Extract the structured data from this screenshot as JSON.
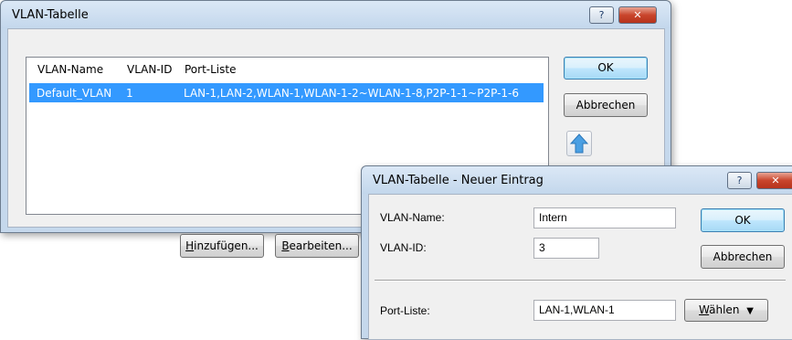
{
  "main_dialog": {
    "title": "VLAN-Tabelle",
    "help_glyph": "?",
    "close_glyph": "✕",
    "columns": [
      "VLAN-Name",
      "VLAN-ID",
      "Port-Liste"
    ],
    "rows": [
      {
        "vlan_name": "Default_VLAN",
        "vlan_id": "1",
        "port_list": "LAN-1,LAN-2,WLAN-1,WLAN-1-2~WLAN-1-8,P2P-1-1~P2P-1-6"
      }
    ],
    "ok_label": "OK",
    "cancel_label": "Abbrechen",
    "add_label": "Hinzufügen...",
    "add_mnemonic": "H",
    "add_rest": "inzufügen...",
    "edit_mnemonic": "B",
    "edit_rest": "earbeiten...",
    "move_up_icon": "up-arrow-icon",
    "colors": {
      "selection": "#3399ff",
      "arrow": "#4a9fe3"
    }
  },
  "entry_dialog": {
    "title": "VLAN-Tabelle - Neuer Eintrag",
    "help_glyph": "?",
    "close_glyph": "✕",
    "vlan_name_label": "VLAN-Name:",
    "vlan_name_value": "Intern",
    "vlan_id_label": "VLAN-ID:",
    "vlan_id_value": "3",
    "port_list_label": "Port-Liste:",
    "port_list_value": "LAN-1,WLAN-1",
    "ok_label": "OK",
    "cancel_label": "Abbrechen",
    "choose_mnemonic": "W",
    "choose_rest": "ählen",
    "choose_arrow": "▼"
  }
}
